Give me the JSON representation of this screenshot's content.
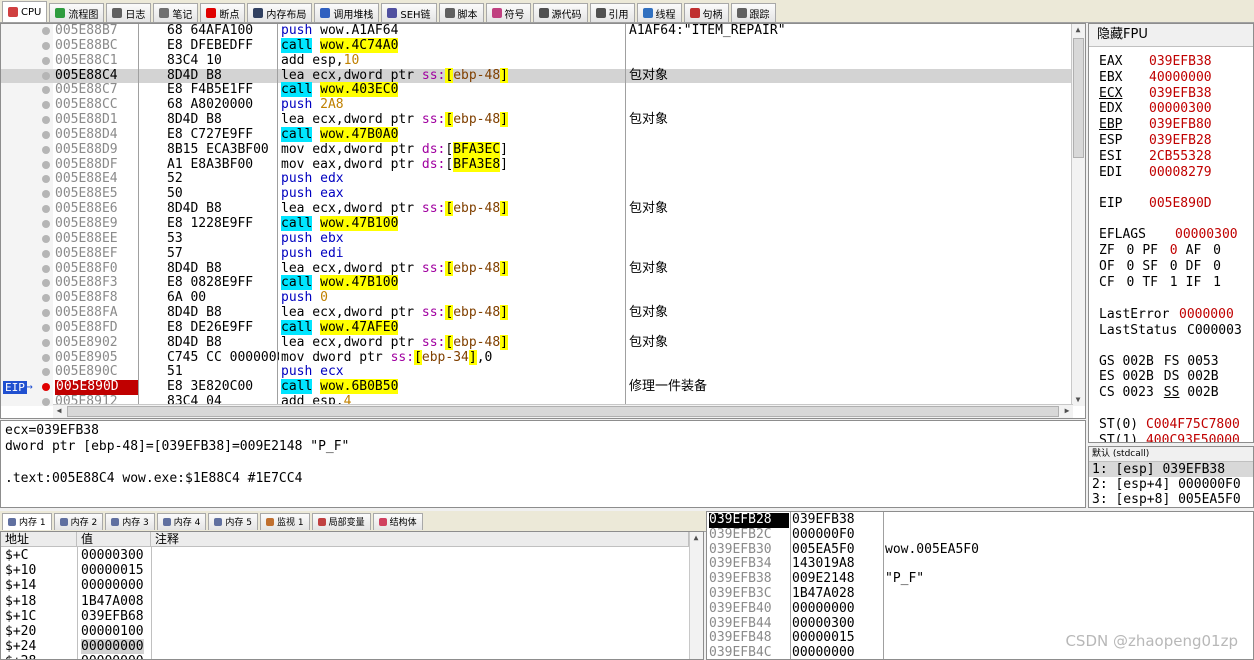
{
  "tabs": [
    {
      "label": "CPU",
      "color": "#d04040",
      "icon": "cpu-icon"
    },
    {
      "label": "流程图",
      "color": "#2e9c3e",
      "icon": "graph-icon"
    },
    {
      "label": "日志",
      "color": "#606060",
      "icon": "log-icon"
    },
    {
      "label": "笔记",
      "color": "#707070",
      "icon": "notes-icon"
    },
    {
      "label": "断点",
      "color": "#e00000",
      "icon": "breakpoint-icon"
    },
    {
      "label": "内存布局",
      "color": "#304060",
      "icon": "memory-map-icon"
    },
    {
      "label": "调用堆栈",
      "color": "#3060c0",
      "icon": "call-stack-icon"
    },
    {
      "label": "SEH链",
      "color": "#5050a0",
      "icon": "seh-icon"
    },
    {
      "label": "脚本",
      "color": "#606060",
      "icon": "script-icon"
    },
    {
      "label": "符号",
      "color": "#c04080",
      "icon": "symbols-icon"
    },
    {
      "label": "源代码",
      "color": "#505050",
      "icon": "source-icon"
    },
    {
      "label": "引用",
      "color": "#505050",
      "icon": "references-icon"
    },
    {
      "label": "线程",
      "color": "#3070c0",
      "icon": "threads-icon"
    },
    {
      "label": "句柄",
      "color": "#c03030",
      "icon": "handles-icon"
    },
    {
      "label": "跟踪",
      "color": "#606060",
      "icon": "trace-icon"
    }
  ],
  "disasm": {
    "eip_label": "EIP",
    "rows": [
      {
        "addr": "005E88B7",
        "bytes": "68 64AFA100",
        "instr": [
          [
            "kw",
            "push "
          ],
          [
            "",
            "wow.A1AF64"
          ]
        ],
        "comment": "A1AF64:\"ITEM_REPAIR\"",
        "cstyle": "str"
      },
      {
        "addr": "005E88BC",
        "bytes": "E8 DFEBEDFF",
        "instr": [
          [
            "call",
            "call"
          ],
          [
            "",
            " "
          ],
          [
            "tgt",
            "wow.4C74A0"
          ]
        ],
        "comment": ""
      },
      {
        "addr": "005E88C1",
        "bytes": "83C4 10",
        "instr": [
          [
            "",
            "add esp,"
          ],
          [
            "imm",
            "10"
          ]
        ],
        "comment": ""
      },
      {
        "addr": "005E88C4",
        "bytes": "8D4D B8",
        "instr": [
          [
            "",
            "lea ecx,dword ptr "
          ],
          [
            "seg",
            "ss:"
          ],
          [
            "br",
            "["
          ],
          [
            "mem",
            "ebp-48"
          ],
          [
            "br",
            "]"
          ]
        ],
        "comment": "包对象",
        "sel": true
      },
      {
        "addr": "005E88C7",
        "bytes": "E8 F4B5E1FF",
        "instr": [
          [
            "call",
            "call"
          ],
          [
            "",
            " "
          ],
          [
            "tgt",
            "wow.403EC0"
          ]
        ],
        "comment": ""
      },
      {
        "addr": "005E88CC",
        "bytes": "68 A8020000",
        "instr": [
          [
            "kw",
            "push "
          ],
          [
            "imm",
            "2A8"
          ]
        ],
        "comment": ""
      },
      {
        "addr": "005E88D1",
        "bytes": "8D4D B8",
        "instr": [
          [
            "",
            "lea ecx,dword ptr "
          ],
          [
            "seg",
            "ss:"
          ],
          [
            "br",
            "["
          ],
          [
            "mem",
            "ebp-48"
          ],
          [
            "br",
            "]"
          ]
        ],
        "comment": "包对象"
      },
      {
        "addr": "005E88D4",
        "bytes": "E8 C727E9FF",
        "instr": [
          [
            "call",
            "call"
          ],
          [
            "",
            " "
          ],
          [
            "tgt",
            "wow.47B0A0"
          ]
        ],
        "comment": ""
      },
      {
        "addr": "005E88D9",
        "bytes": "8B15 ECA3BF00",
        "instr": [
          [
            "",
            "mov edx,dword ptr "
          ],
          [
            "seg",
            "ds:"
          ],
          [
            "",
            "["
          ],
          [
            "tgt",
            "BFA3EC"
          ],
          [
            "",
            "]"
          ]
        ],
        "comment": ""
      },
      {
        "addr": "005E88DF",
        "bytes": "A1 E8A3BF00",
        "instr": [
          [
            "",
            "mov eax,dword ptr "
          ],
          [
            "seg",
            "ds:"
          ],
          [
            "",
            "["
          ],
          [
            "tgt",
            "BFA3E8"
          ],
          [
            "",
            "]"
          ]
        ],
        "comment": ""
      },
      {
        "addr": "005E88E4",
        "bytes": "52",
        "instr": [
          [
            "kw",
            "push "
          ],
          [
            "kw",
            "edx"
          ]
        ],
        "comment": ""
      },
      {
        "addr": "005E88E5",
        "bytes": "50",
        "instr": [
          [
            "kw",
            "push "
          ],
          [
            "kw",
            "eax"
          ]
        ],
        "comment": ""
      },
      {
        "addr": "005E88E6",
        "bytes": "8D4D B8",
        "instr": [
          [
            "",
            "lea ecx,dword ptr "
          ],
          [
            "seg",
            "ss:"
          ],
          [
            "br",
            "["
          ],
          [
            "mem",
            "ebp-48"
          ],
          [
            "br",
            "]"
          ]
        ],
        "comment": "包对象"
      },
      {
        "addr": "005E88E9",
        "bytes": "E8 1228E9FF",
        "instr": [
          [
            "call",
            "call"
          ],
          [
            "",
            " "
          ],
          [
            "tgt",
            "wow.47B100"
          ]
        ],
        "comment": ""
      },
      {
        "addr": "005E88EE",
        "bytes": "53",
        "instr": [
          [
            "kw",
            "push "
          ],
          [
            "kw",
            "ebx"
          ]
        ],
        "comment": ""
      },
      {
        "addr": "005E88EF",
        "bytes": "57",
        "instr": [
          [
            "kw",
            "push "
          ],
          [
            "kw",
            "edi"
          ]
        ],
        "comment": ""
      },
      {
        "addr": "005E88F0",
        "bytes": "8D4D B8",
        "instr": [
          [
            "",
            "lea ecx,dword ptr "
          ],
          [
            "seg",
            "ss:"
          ],
          [
            "br",
            "["
          ],
          [
            "mem",
            "ebp-48"
          ],
          [
            "br",
            "]"
          ]
        ],
        "comment": "包对象"
      },
      {
        "addr": "005E88F3",
        "bytes": "E8 0828E9FF",
        "instr": [
          [
            "call",
            "call"
          ],
          [
            "",
            " "
          ],
          [
            "tgt",
            "wow.47B100"
          ]
        ],
        "comment": ""
      },
      {
        "addr": "005E88F8",
        "bytes": "6A 00",
        "instr": [
          [
            "kw",
            "push "
          ],
          [
            "imm",
            "0"
          ]
        ],
        "comment": ""
      },
      {
        "addr": "005E88FA",
        "bytes": "8D4D B8",
        "instr": [
          [
            "",
            "lea ecx,dword ptr "
          ],
          [
            "seg",
            "ss:"
          ],
          [
            "br",
            "["
          ],
          [
            "mem",
            "ebp-48"
          ],
          [
            "br",
            "]"
          ]
        ],
        "comment": "包对象"
      },
      {
        "addr": "005E88FD",
        "bytes": "E8 DE26E9FF",
        "instr": [
          [
            "call",
            "call"
          ],
          [
            "",
            " "
          ],
          [
            "tgt",
            "wow.47AFE0"
          ]
        ],
        "comment": ""
      },
      {
        "addr": "005E8902",
        "bytes": "8D4D B8",
        "instr": [
          [
            "",
            "lea ecx,dword ptr "
          ],
          [
            "seg",
            "ss:"
          ],
          [
            "br",
            "["
          ],
          [
            "mem",
            "ebp-48"
          ],
          [
            "br",
            "]"
          ]
        ],
        "comment": "包对象"
      },
      {
        "addr": "005E8905",
        "bytes": "C745 CC 00000000",
        "instr": [
          [
            "",
            "mov dword ptr "
          ],
          [
            "seg",
            "ss:"
          ],
          [
            "br",
            "["
          ],
          [
            "mem",
            "ebp-34"
          ],
          [
            "br",
            "]"
          ],
          [
            "",
            ",0"
          ]
        ],
        "comment": ""
      },
      {
        "addr": "005E890C",
        "bytes": "51",
        "instr": [
          [
            "kw",
            "push "
          ],
          [
            "kw",
            "ecx"
          ]
        ],
        "comment": ""
      },
      {
        "addr": "005E890D",
        "bytes": "E8 3E820C00",
        "instr": [
          [
            "call",
            "call"
          ],
          [
            "",
            " "
          ],
          [
            "tgt",
            "wow.6B0B50"
          ]
        ],
        "comment": "修理一件装备",
        "eip": true
      },
      {
        "addr": "005E8912",
        "bytes": "83C4 04",
        "instr": [
          [
            "",
            "add esp,"
          ],
          [
            "imm",
            "4"
          ]
        ],
        "comment": ""
      }
    ]
  },
  "info": {
    "line1": "ecx=039EFB38",
    "line2": "dword ptr [ebp-48]=[039EFB38]=009E2148 \"P_F\"",
    "line3": "",
    "line4": ".text:005E88C4 wow.exe:$1E88C4 #1E7CC4"
  },
  "registers": {
    "header": "隐藏FPU",
    "gp": [
      {
        "name": "EAX",
        "value": "039EFB38"
      },
      {
        "name": "EBX",
        "value": "40000000"
      },
      {
        "name": "ECX",
        "value": "039EFB38",
        "ul": true
      },
      {
        "name": "EDX",
        "value": "00000300"
      },
      {
        "name": "EBP",
        "value": "039EFB80",
        "ul": true
      },
      {
        "name": "ESP",
        "value": "039EFB28"
      },
      {
        "name": "ESI",
        "value": "2CB55328"
      },
      {
        "name": "EDI",
        "value": "00008279"
      }
    ],
    "eip": {
      "name": "EIP",
      "value": "005E890D"
    },
    "eflags": {
      "name": "EFLAGS",
      "value": "00000300"
    },
    "flags": [
      [
        [
          "ZF",
          "0"
        ],
        [
          "PF",
          "0"
        ],
        [
          "AF",
          "0"
        ]
      ],
      [
        [
          "OF",
          "0"
        ],
        [
          "SF",
          "0"
        ],
        [
          "DF",
          "0"
        ]
      ],
      [
        [
          "CF",
          "0"
        ],
        [
          "TF",
          "1"
        ],
        [
          "IF",
          "1"
        ]
      ]
    ],
    "last_error": {
      "name": "LastError",
      "value": "0000000"
    },
    "last_status": {
      "name": "LastStatus",
      "value": "C000003"
    },
    "seg": [
      [
        [
          "GS",
          "002B"
        ],
        [
          "FS",
          "0053"
        ]
      ],
      [
        [
          "ES",
          "002B"
        ],
        [
          "DS",
          "002B"
        ]
      ],
      [
        [
          "CS",
          "0023"
        ],
        [
          "SS",
          "002B"
        ]
      ]
    ],
    "fpu": [
      {
        "name": "ST(0)",
        "value": "C004F75C7800"
      },
      {
        "name": "ST(1)",
        "value": "400C93E50000"
      }
    ]
  },
  "stack_hint": {
    "header": "默认 (stdcall)",
    "lines": [
      "1: [esp] 039EFB38",
      "2: [esp+4] 000000F0",
      "3: [esp+8] 005EA5F0"
    ]
  },
  "mem_tabs": [
    "内存 1",
    "内存 2",
    "内存 3",
    "内存 4",
    "内存 5",
    "监视 1",
    "局部变量",
    "结构体"
  ],
  "watch": {
    "columns": [
      "地址",
      "值",
      "注释"
    ],
    "rows": [
      {
        "a": "$+C",
        "v": "00000300"
      },
      {
        "a": "$+10",
        "v": "00000015"
      },
      {
        "a": "$+14",
        "v": "00000000"
      },
      {
        "a": "$+18",
        "v": "1B47A008"
      },
      {
        "a": "$+1C",
        "v": "039EFB68"
      },
      {
        "a": "$+20",
        "v": "00000100"
      },
      {
        "a": "$+24",
        "v": "00000000",
        "sel": true
      },
      {
        "a": "$+28",
        "v": "00000000"
      }
    ]
  },
  "stack": {
    "rows": [
      {
        "a": "039EFB28",
        "v": "039EFB38",
        "c": "",
        "sel": true
      },
      {
        "a": "039EFB2C",
        "v": "000000F0",
        "c": ""
      },
      {
        "a": "039EFB30",
        "v": "005EA5F0",
        "c": "wow.005EA5F0"
      },
      {
        "a": "039EFB34",
        "v": "143019A8",
        "c": ""
      },
      {
        "a": "039EFB38",
        "v": "009E2148",
        "c": "\"P_F\""
      },
      {
        "a": "039EFB3C",
        "v": "1B47A028",
        "c": ""
      },
      {
        "a": "039EFB40",
        "v": "00000000",
        "c": ""
      },
      {
        "a": "039EFB44",
        "v": "00000300",
        "c": ""
      },
      {
        "a": "039EFB48",
        "v": "00000015",
        "c": ""
      },
      {
        "a": "039EFB4C",
        "v": "00000000",
        "c": ""
      }
    ]
  },
  "watermark": "CSDN @zhaopeng01zp"
}
